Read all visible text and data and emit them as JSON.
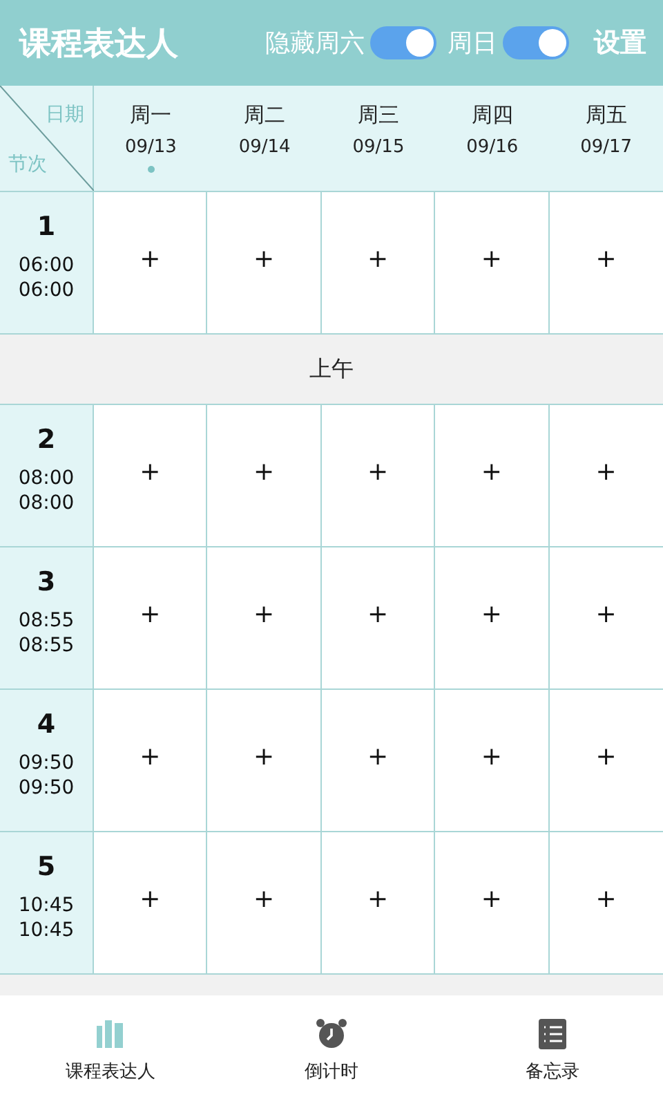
{
  "app_bar": {
    "title": "课程表达人",
    "toggles": [
      {
        "label": "隐藏周六",
        "on": true
      },
      {
        "label": "周日",
        "on": true
      }
    ],
    "settings": "设置"
  },
  "corner": {
    "top": "日期",
    "bottom": "节次"
  },
  "days": [
    {
      "name": "周一",
      "date": "09/13",
      "today": true
    },
    {
      "name": "周二",
      "date": "09/14",
      "today": false
    },
    {
      "name": "周三",
      "date": "09/15",
      "today": false
    },
    {
      "name": "周四",
      "date": "09/16",
      "today": false
    },
    {
      "name": "周五",
      "date": "09/17",
      "today": false
    }
  ],
  "rows": [
    {
      "kind": "period",
      "number": "1",
      "start": "06:00",
      "end": "06:00",
      "cells": [
        "+",
        "+",
        "+",
        "+",
        "+"
      ]
    },
    {
      "kind": "section",
      "label": "上午"
    },
    {
      "kind": "period",
      "number": "2",
      "start": "08:00",
      "end": "08:00",
      "cells": [
        "+",
        "+",
        "+",
        "+",
        "+"
      ]
    },
    {
      "kind": "period",
      "number": "3",
      "start": "08:55",
      "end": "08:55",
      "cells": [
        "+",
        "+",
        "+",
        "+",
        "+"
      ]
    },
    {
      "kind": "period",
      "number": "4",
      "start": "09:50",
      "end": "09:50",
      "cells": [
        "+",
        "+",
        "+",
        "+",
        "+"
      ]
    },
    {
      "kind": "period",
      "number": "5",
      "start": "10:45",
      "end": "10:45",
      "cells": [
        "+",
        "+",
        "+",
        "+",
        "+"
      ]
    },
    {
      "kind": "section"
    }
  ],
  "bottom_nav": [
    {
      "label": "课程表达人",
      "kind": "books",
      "selected": true
    },
    {
      "label": "倒计时",
      "kind": "alarm",
      "selected": false
    },
    {
      "label": "备忘录",
      "kind": "list",
      "selected": false
    }
  ]
}
